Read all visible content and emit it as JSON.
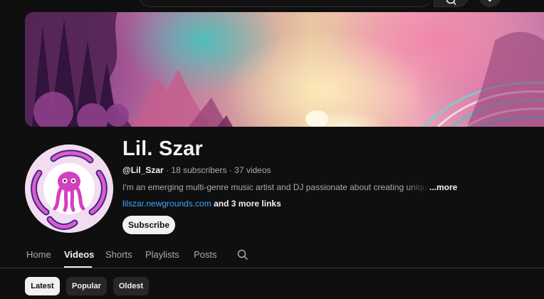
{
  "header": {
    "search_icon": "search-icon",
    "mic_icon": "mic-icon"
  },
  "banner": {
    "description_icon": "banner-art"
  },
  "channel": {
    "name": "Lil. Szar",
    "handle": "@Lil_Szar",
    "subscribers": "18 subscribers",
    "separator": "·",
    "videos": "37 videos",
    "description": "I'm an emerging multi-genre music artist and DJ passionate about creating unique sounds",
    "more_label": "...more",
    "link_text": "lilszar.newgrounds.com",
    "more_links": "and 3 more links",
    "subscribe_label": "Subscribe"
  },
  "tabs": [
    {
      "label": "Home"
    },
    {
      "label": "Videos"
    },
    {
      "label": "Shorts"
    },
    {
      "label": "Playlists"
    },
    {
      "label": "Posts"
    }
  ],
  "active_tab": "Videos",
  "chips": [
    {
      "label": "Latest"
    },
    {
      "label": "Popular"
    },
    {
      "label": "Oldest"
    }
  ],
  "selected_chip": "Latest",
  "colors": {
    "background": "#0f0f0f",
    "link": "#3ea6ff",
    "text_primary": "#f1f1f1",
    "text_secondary": "#aaaaaa"
  }
}
